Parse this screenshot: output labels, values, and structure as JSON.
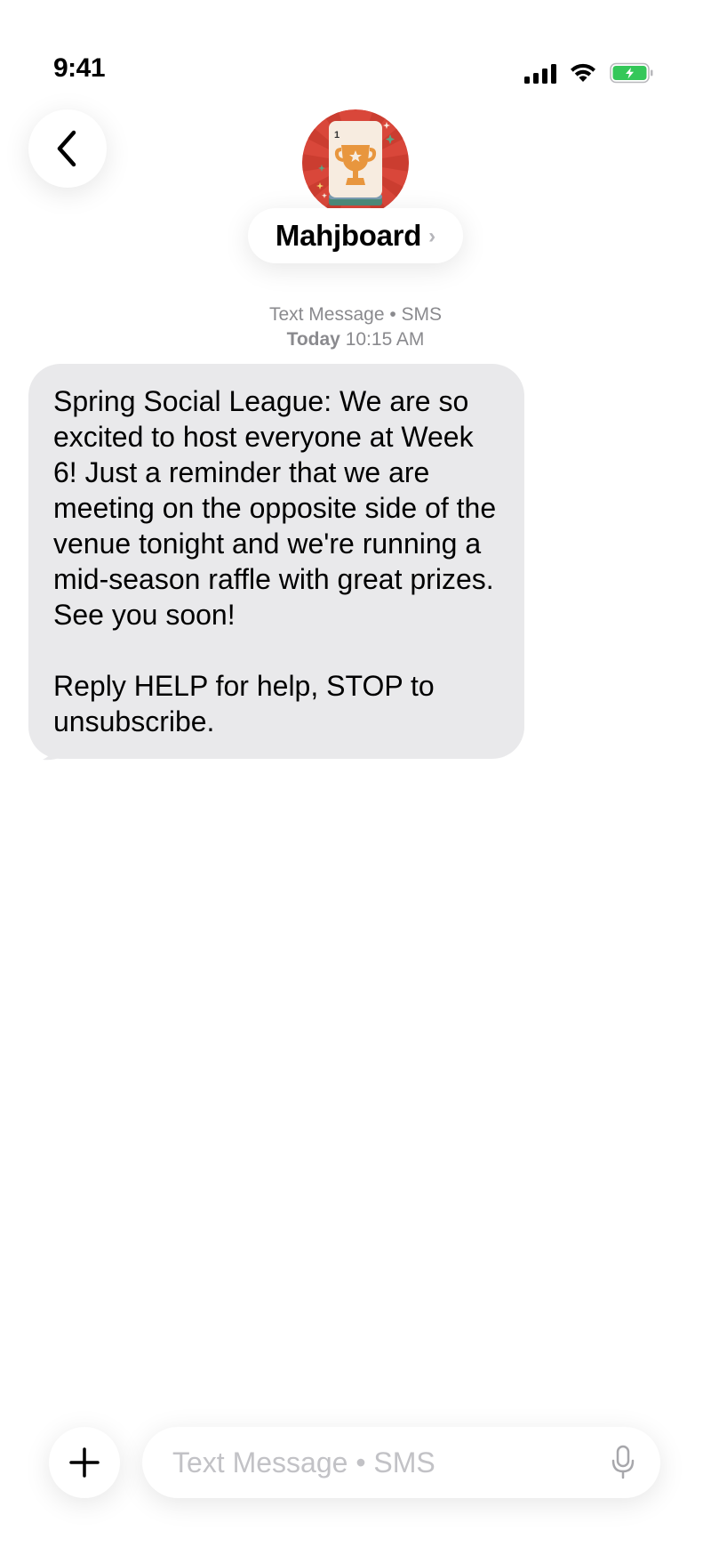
{
  "status_bar": {
    "time": "9:41",
    "battery_color": "#34c759"
  },
  "header": {
    "back_icon": "chevron-left-icon",
    "contact_name": "Mahjboard",
    "contact_chevron": "›",
    "avatar": {
      "tile_number": "1",
      "icon": "trophy-icon",
      "background_color": "#d9473a",
      "trophy_color": "#e8963e"
    }
  },
  "conversation": {
    "service_label": "Text Message • SMS",
    "date_day": "Today",
    "date_time": "10:15 AM",
    "messages": [
      {
        "direction": "incoming",
        "text": "Spring Social League: We are so excited to host everyone at Week 6! Just a reminder that we are meeting on the opposite side of the venue tonight and we're running a mid-season raffle with great prizes. See you soon!\n\nReply HELP for help, STOP to unsubscribe.",
        "bubble_color": "#e9e9eb"
      }
    ]
  },
  "composer": {
    "plus_icon": "plus-icon",
    "placeholder": "Text Message • SMS",
    "value": "",
    "mic_icon": "microphone-icon"
  }
}
